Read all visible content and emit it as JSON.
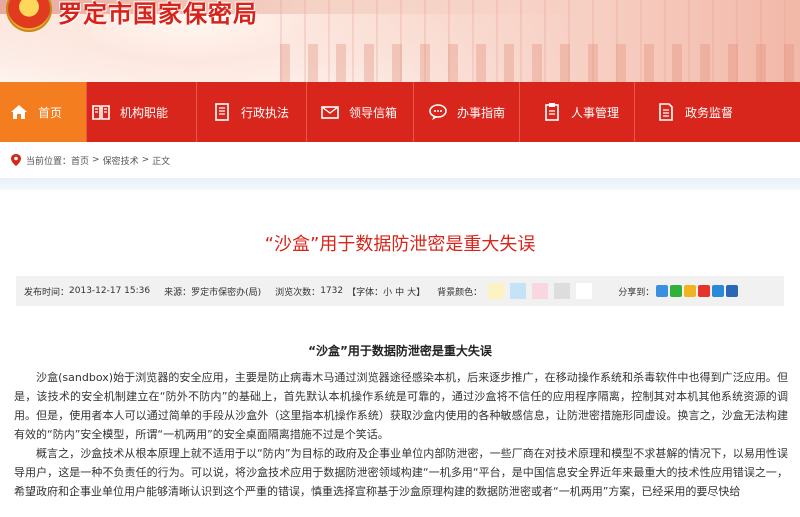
{
  "site": {
    "title": "罗定市国家保密局"
  },
  "nav": {
    "items": [
      {
        "label": "首页",
        "icon": "home-icon"
      },
      {
        "label": "机构职能",
        "icon": "book-icon"
      },
      {
        "label": "行政执法",
        "icon": "document-icon"
      },
      {
        "label": "领导信箱",
        "icon": "mail-icon"
      },
      {
        "label": "办事指南",
        "icon": "chat-icon"
      },
      {
        "label": "人事管理",
        "icon": "clipboard-icon"
      },
      {
        "label": "政务监督",
        "icon": "file-list-icon"
      }
    ]
  },
  "breadcrumb": {
    "prefix": "当前位置：",
    "items": [
      "首页",
      "保密技术",
      "正文"
    ],
    "separator": ">"
  },
  "article": {
    "title": "“沙盒”用于数据防泄密是重大失误",
    "meta": {
      "publish_label": "发布时间：",
      "publish_time": "2013-12-17 15:36",
      "source_label": "来源：",
      "source": "罗定市保密办(局)",
      "views_label": "浏览次数：",
      "views": "1732",
      "font_label": "【字体：",
      "font_small": "小",
      "font_medium": "中",
      "font_large": "大",
      "font_close": "】",
      "bg_label": "背景颜色：",
      "bg_colors": [
        "#fdf3c2",
        "#c4e3f6",
        "#f9d7de",
        "#dddddd",
        "#ffffff"
      ],
      "share_label": "分享到："
    },
    "share_icons": [
      {
        "name": "share-plus-icon",
        "color": "#3b8fe0"
      },
      {
        "name": "share-wechat-icon",
        "color": "#2fb13a"
      },
      {
        "name": "share-qzone-icon",
        "color": "#f2b320"
      },
      {
        "name": "share-weibo-icon",
        "color": "#e6342a"
      },
      {
        "name": "share-tencent-icon",
        "color": "#2a8ad8"
      },
      {
        "name": "share-renren-icon",
        "color": "#2c67b7"
      }
    ],
    "subtitle": "“沙盒”用于数据防泄密是重大失误",
    "paragraphs": [
      "沙盒(sandbox)始于浏览器的安全应用，主要是防止病毒木马通过浏览器途径感染本机，后来逐步推广，在移动操作系统和杀毒软件中也得到广泛应用。但是，该技术的安全机制建立在“防外不防内”的基础上，首先默认本机操作系统是可靠的，通过沙盒将不信任的应用程序隔离，控制其对本机其他系统资源的调用。但是，使用者本人可以通过简单的手段从沙盒外（这里指本机操作系统）获取沙盒内使用的各种敏感信息，让防泄密措施形同虚设。换言之，沙盒无法构建有效的“防内”安全模型，所谓“一机两用”的安全桌面隔离措施不过是个笑话。",
      "概言之，沙盒技术从根本原理上就不适用于以“防内”为目标的政府及企事业单位内部防泄密，一些厂商在对技术原理和模型不求甚解的情况下，以易用性误导用户，这是一种不负责任的行为。可以说，将沙盒技术应用于数据防泄密领域构建“一机多用“平台，是中国信息安全界近年来最重大的技术性应用错误之一，希望政府和企事业单位用户能够清晰认识到这个严重的错误，慎重选择宣称基于沙盒原理构建的数据防泄密或者“一机两用”方案，已经采用的要尽快给"
    ]
  },
  "colors": {
    "nav_bg": "#d9261c",
    "nav_active": "#f47d1f",
    "title_red": "#d9261c"
  }
}
